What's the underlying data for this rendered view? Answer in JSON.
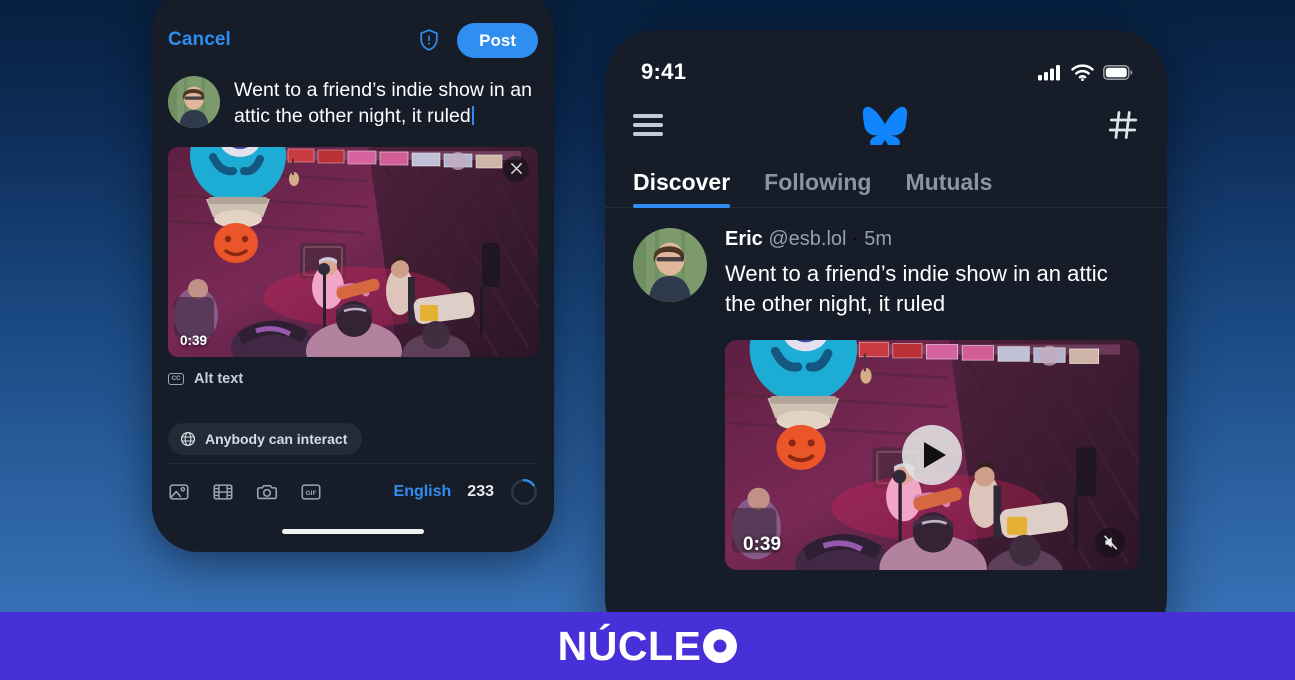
{
  "background": {
    "gradient_top": "#07203f",
    "gradient_bottom": "#3d78bf"
  },
  "footer": {
    "brand_text": "NÚCLE",
    "brand_ring_icon": "ring-o-icon",
    "background_color": "#4830d8"
  },
  "composer": {
    "cancel_label": "Cancel",
    "shield_icon": "shield-alert-icon",
    "post_label": "Post",
    "accent_color": "#2f8ef0",
    "avatar_icon": "user-avatar",
    "text": "Went to a friend’s indie show in an attic the other night, it ruled",
    "media": {
      "close_icon": "close-icon",
      "duration": "0:39"
    },
    "alt_text": {
      "icon": "cc-icon",
      "icon_label": "CC",
      "label": "Alt text"
    },
    "interaction_chip": {
      "icon": "globe-icon",
      "label": "Anybody can interact"
    },
    "toolbar": {
      "icons": [
        {
          "name": "image-icon"
        },
        {
          "name": "video-icon"
        },
        {
          "name": "camera-icon"
        },
        {
          "name": "gif-icon",
          "label": "GIF"
        }
      ],
      "language_label": "English",
      "char_count": "233",
      "count_ring_icon": "progress-ring-icon"
    }
  },
  "feed": {
    "statusbar": {
      "time": "9:41",
      "cellular_icon": "cellular-signal-icon",
      "wifi_icon": "wifi-icon",
      "battery_icon": "battery-full-icon"
    },
    "header": {
      "menu_icon": "hamburger-menu-icon",
      "logo_icon": "bluesky-butterfly-icon",
      "logo_color": "#1185fe",
      "hashtag_icon": "hashtag-icon"
    },
    "tabs": [
      {
        "label": "Discover",
        "active": true
      },
      {
        "label": "Following",
        "active": false
      },
      {
        "label": "Mutuals",
        "active": false
      }
    ],
    "post": {
      "avatar_icon": "user-avatar",
      "author": "Eric",
      "handle": "@esb.lol",
      "separator": "·",
      "timestamp": "5m",
      "text": "Went to a friend’s indie show in an attic the other night, it ruled",
      "media": {
        "play_icon": "play-icon",
        "duration": "0:39",
        "mute_icon": "speaker-muted-icon"
      }
    }
  }
}
